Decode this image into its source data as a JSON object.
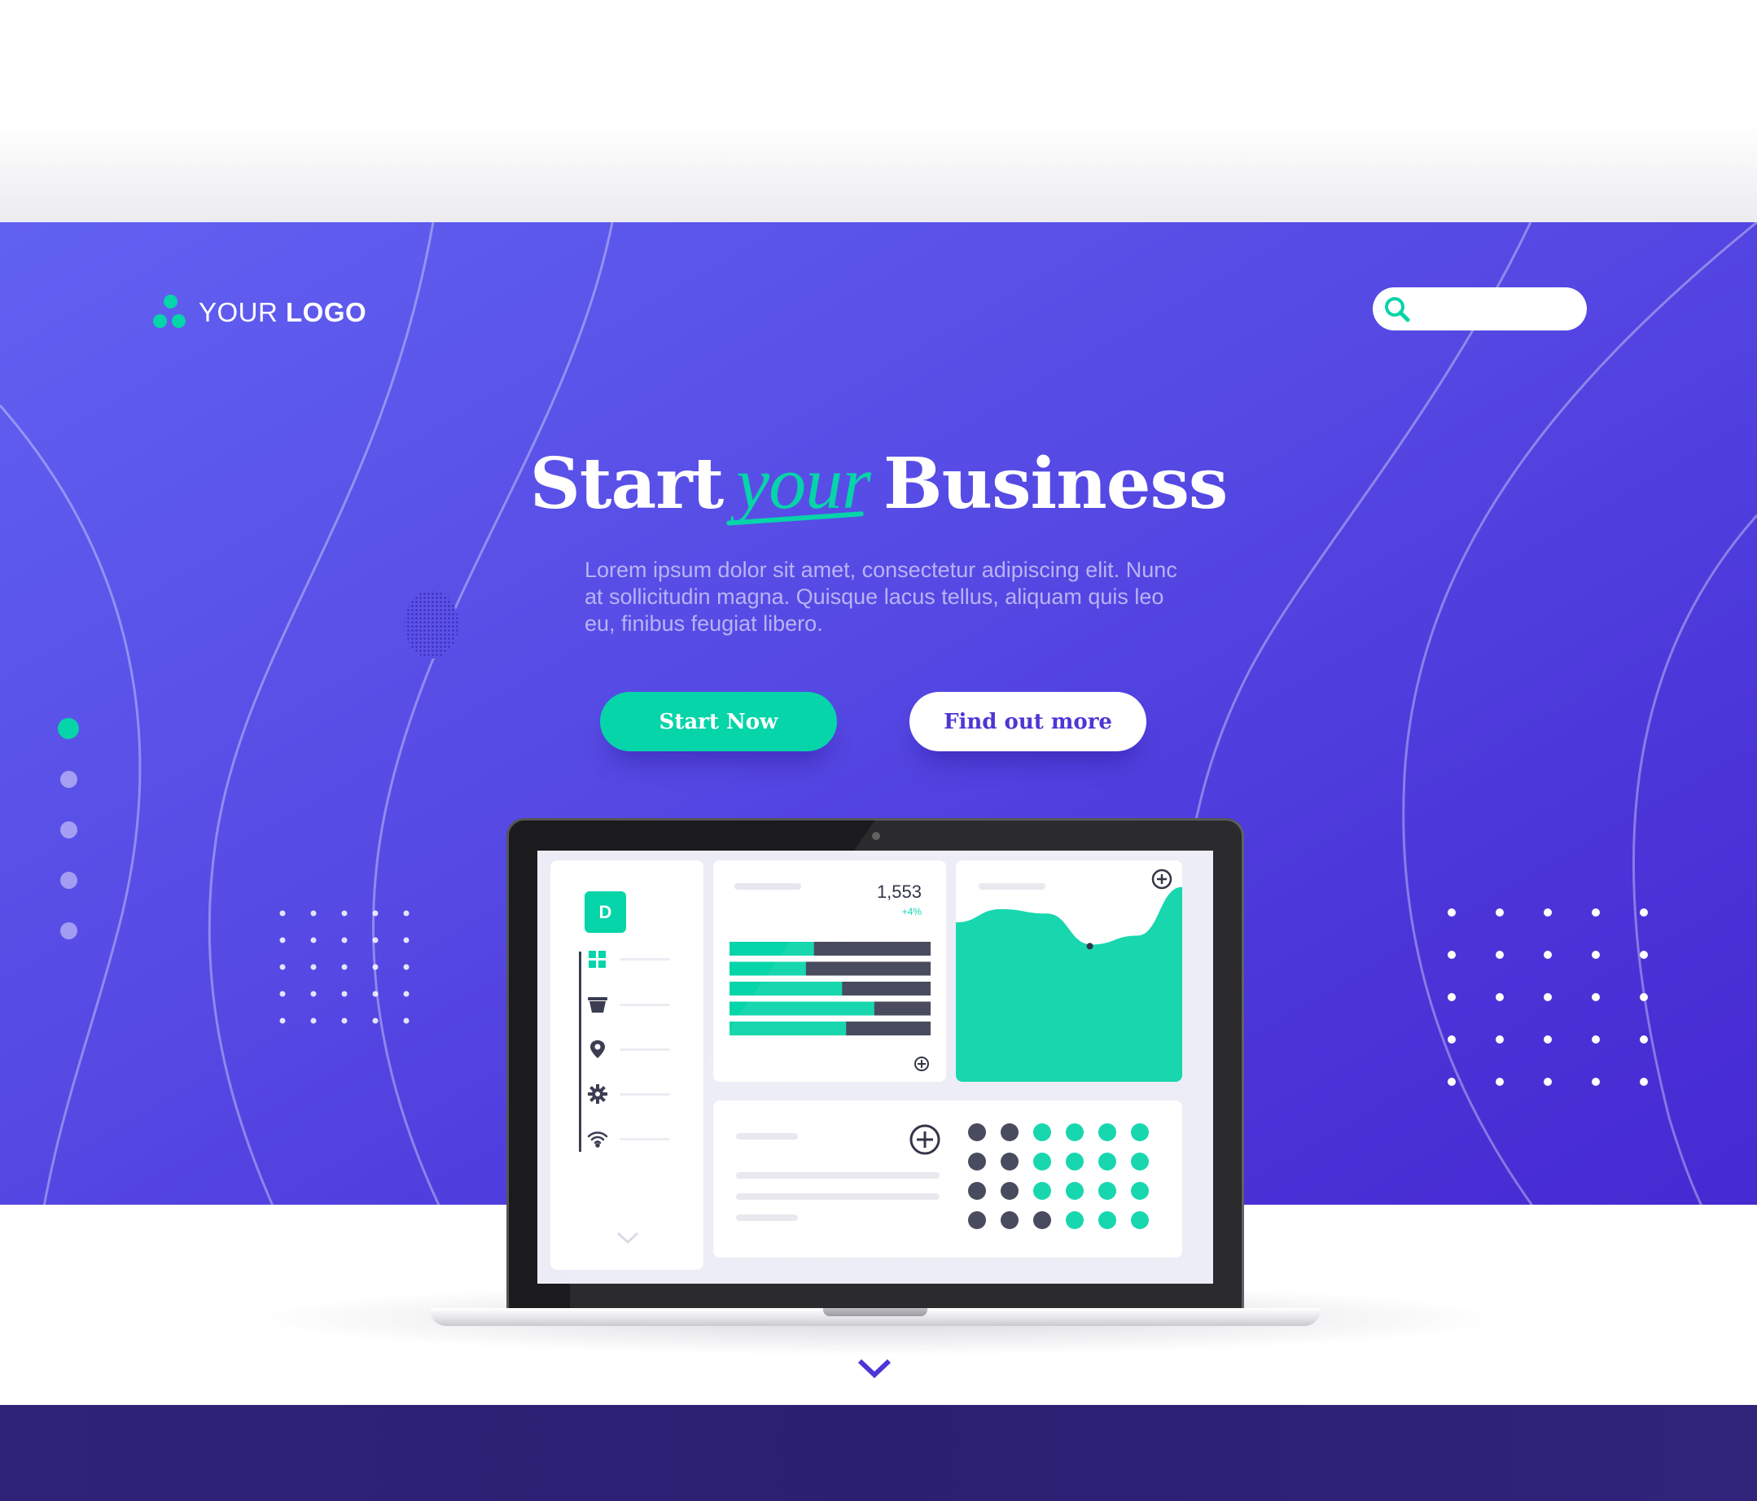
{
  "brand": {
    "logo_light": "YOUR",
    "logo_bold": "LOGO",
    "accent_color": "#06d4a9",
    "primary_color": "#4b36d6"
  },
  "search": {
    "placeholder": "",
    "icon": "search-icon"
  },
  "hero": {
    "title_start": "Start",
    "title_accent": "your",
    "title_end": "Business",
    "lead": "Lorem ipsum dolor sit amet, consectetur adipiscing elit. Nunc at sollicitudin magna. Quisque lacus tellus, aliquam quis leo eu, finibus feugiat libero.",
    "primary_button": "Start Now",
    "secondary_button": "Find out more"
  },
  "pager": {
    "count": 5,
    "active_index": 0
  },
  "dashboard": {
    "badge_letter": "D",
    "sidebar_icons": [
      "grid-icon",
      "bucket-icon",
      "location-pin-icon",
      "gear-icon",
      "wifi-icon"
    ],
    "stat_value": "1,553",
    "stat_change": "+4%",
    "progress_bars": [
      0.42,
      0.38,
      0.56,
      0.72,
      0.58
    ],
    "area_curve": [
      0.72,
      0.78,
      0.76,
      0.62,
      0.66,
      0.88
    ],
    "dot_grid": {
      "rows": 4,
      "cols": 6,
      "dark_counts": [
        2,
        2,
        2,
        3
      ]
    }
  }
}
